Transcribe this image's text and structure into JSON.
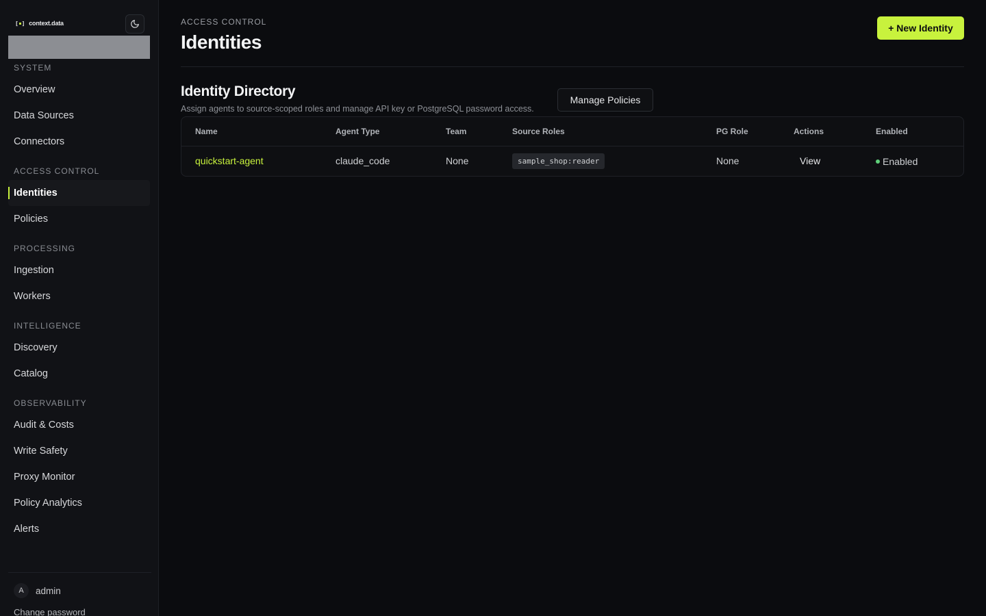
{
  "brand": {
    "name": "context.data"
  },
  "sidebar": {
    "sections": [
      {
        "label": "SYSTEM",
        "items": [
          {
            "label": "Overview"
          },
          {
            "label": "Data Sources"
          },
          {
            "label": "Connectors"
          }
        ]
      },
      {
        "label": "ACCESS CONTROL",
        "items": [
          {
            "label": "Identities",
            "active": true
          },
          {
            "label": "Policies"
          }
        ]
      },
      {
        "label": "PROCESSING",
        "items": [
          {
            "label": "Ingestion"
          },
          {
            "label": "Workers"
          }
        ]
      },
      {
        "label": "INTELLIGENCE",
        "items": [
          {
            "label": "Discovery"
          },
          {
            "label": "Catalog"
          }
        ]
      },
      {
        "label": "OBSERVABILITY",
        "items": [
          {
            "label": "Audit & Costs"
          },
          {
            "label": "Write Safety"
          },
          {
            "label": "Proxy Monitor"
          },
          {
            "label": "Policy Analytics"
          },
          {
            "label": "Alerts"
          }
        ]
      }
    ],
    "user": {
      "initial": "A",
      "name": "admin"
    },
    "change_password": "Change password"
  },
  "header": {
    "eyebrow": "ACCESS CONTROL",
    "title": "Identities",
    "new_button": "+ New Identity"
  },
  "directory": {
    "title": "Identity Directory",
    "subtitle": "Assign agents to source-scoped roles and manage API key or PostgreSQL password access.",
    "manage_button": "Manage Policies",
    "columns": [
      "Name",
      "Agent Type",
      "Team",
      "Source Roles",
      "PG Role",
      "Actions",
      "Enabled"
    ],
    "rows": [
      {
        "name": "quickstart-agent",
        "agent_type": "claude_code",
        "team": "None",
        "source_role": "sample_shop:reader",
        "pg_role": "None",
        "action": "View",
        "enabled": "Enabled"
      }
    ]
  },
  "colors": {
    "accent": "#c8f23d",
    "enabled": "#5fd07a",
    "background": "#0b0c0f"
  }
}
